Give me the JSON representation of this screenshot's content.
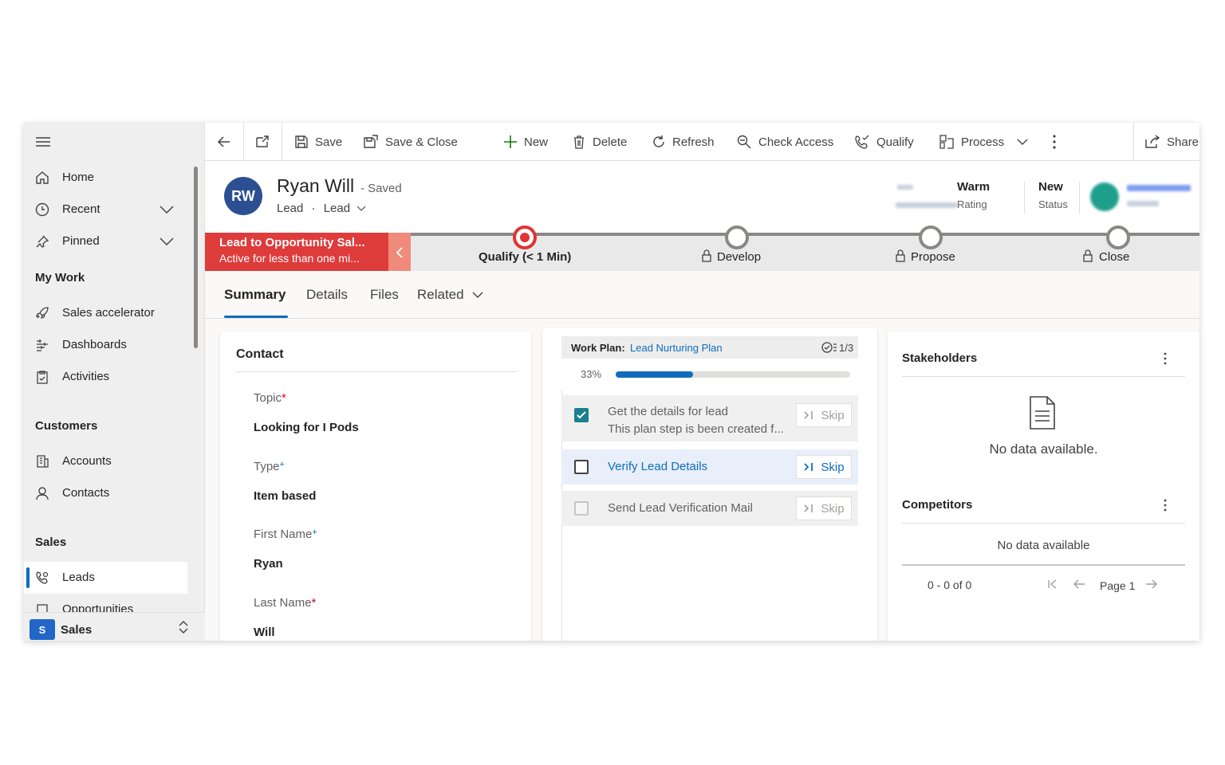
{
  "sidebar": {
    "items": [
      {
        "label": "Home",
        "icon": "home-icon"
      },
      {
        "label": "Recent",
        "icon": "clock-icon"
      },
      {
        "label": "Pinned",
        "icon": "pin-icon"
      }
    ],
    "sections": {
      "my_work": "My Work",
      "customers": "Customers",
      "sales": "Sales"
    },
    "my_work_items": [
      "Sales accelerator",
      "Dashboards",
      "Activities"
    ],
    "customer_items": [
      "Accounts",
      "Contacts"
    ],
    "sales_items": [
      "Leads",
      "Opportunities"
    ],
    "area": {
      "badge": "S",
      "label": "Sales"
    }
  },
  "toolbar": {
    "save": "Save",
    "save_close": "Save & Close",
    "new": "New",
    "delete": "Delete",
    "refresh": "Refresh",
    "check_access": "Check Access",
    "qualify": "Qualify",
    "process": "Process",
    "share": "Share"
  },
  "record": {
    "initials": "RW",
    "name": "Ryan Will",
    "saved": "- Saved",
    "entity": "Lead",
    "form": "Lead",
    "rating_value": "Warm",
    "rating_label": "Rating",
    "status_value": "New",
    "status_label": "Status"
  },
  "bpf": {
    "flag_title": "Lead to Opportunity Sal...",
    "flag_sub": "Active for less than one mi...",
    "stages": [
      {
        "label": "Qualify  (< 1 Min)",
        "active": true
      },
      {
        "label": "Develop",
        "locked": true
      },
      {
        "label": "Propose",
        "locked": true
      },
      {
        "label": "Close",
        "locked": true
      }
    ]
  },
  "tabs": [
    "Summary",
    "Details",
    "Files",
    "Related"
  ],
  "contact": {
    "title": "Contact",
    "fields": [
      {
        "label": "Topic",
        "value": "Looking for I Pods",
        "marker": "*"
      },
      {
        "label": "Type",
        "value": "Item based",
        "marker": "+"
      },
      {
        "label": "First Name",
        "value": "Ryan",
        "marker": "+"
      },
      {
        "label": "Last Name",
        "value": "Will",
        "marker": "*"
      }
    ]
  },
  "workplan": {
    "label": "Work Plan:",
    "name": "Lead Nurturing Plan",
    "count": "1/3",
    "percent": "33%",
    "progress": 0.33,
    "steps": [
      {
        "title": "Get the details for lead",
        "sub": "This plan step is been created f...",
        "done": true
      },
      {
        "title": "Verify Lead Details",
        "active": true
      },
      {
        "title": "Send Lead Verification Mail"
      }
    ],
    "skip": "Skip"
  },
  "stakeholders": {
    "title": "Stakeholders",
    "empty": "No data available."
  },
  "competitors": {
    "title": "Competitors",
    "empty": "No data available",
    "range": "0 - 0 of 0",
    "page": "Page 1"
  },
  "colors": {
    "accent": "#0f6cbd",
    "flag": "#de3b3b",
    "active_stage": "#e03333",
    "check": "#1a7f8e"
  }
}
